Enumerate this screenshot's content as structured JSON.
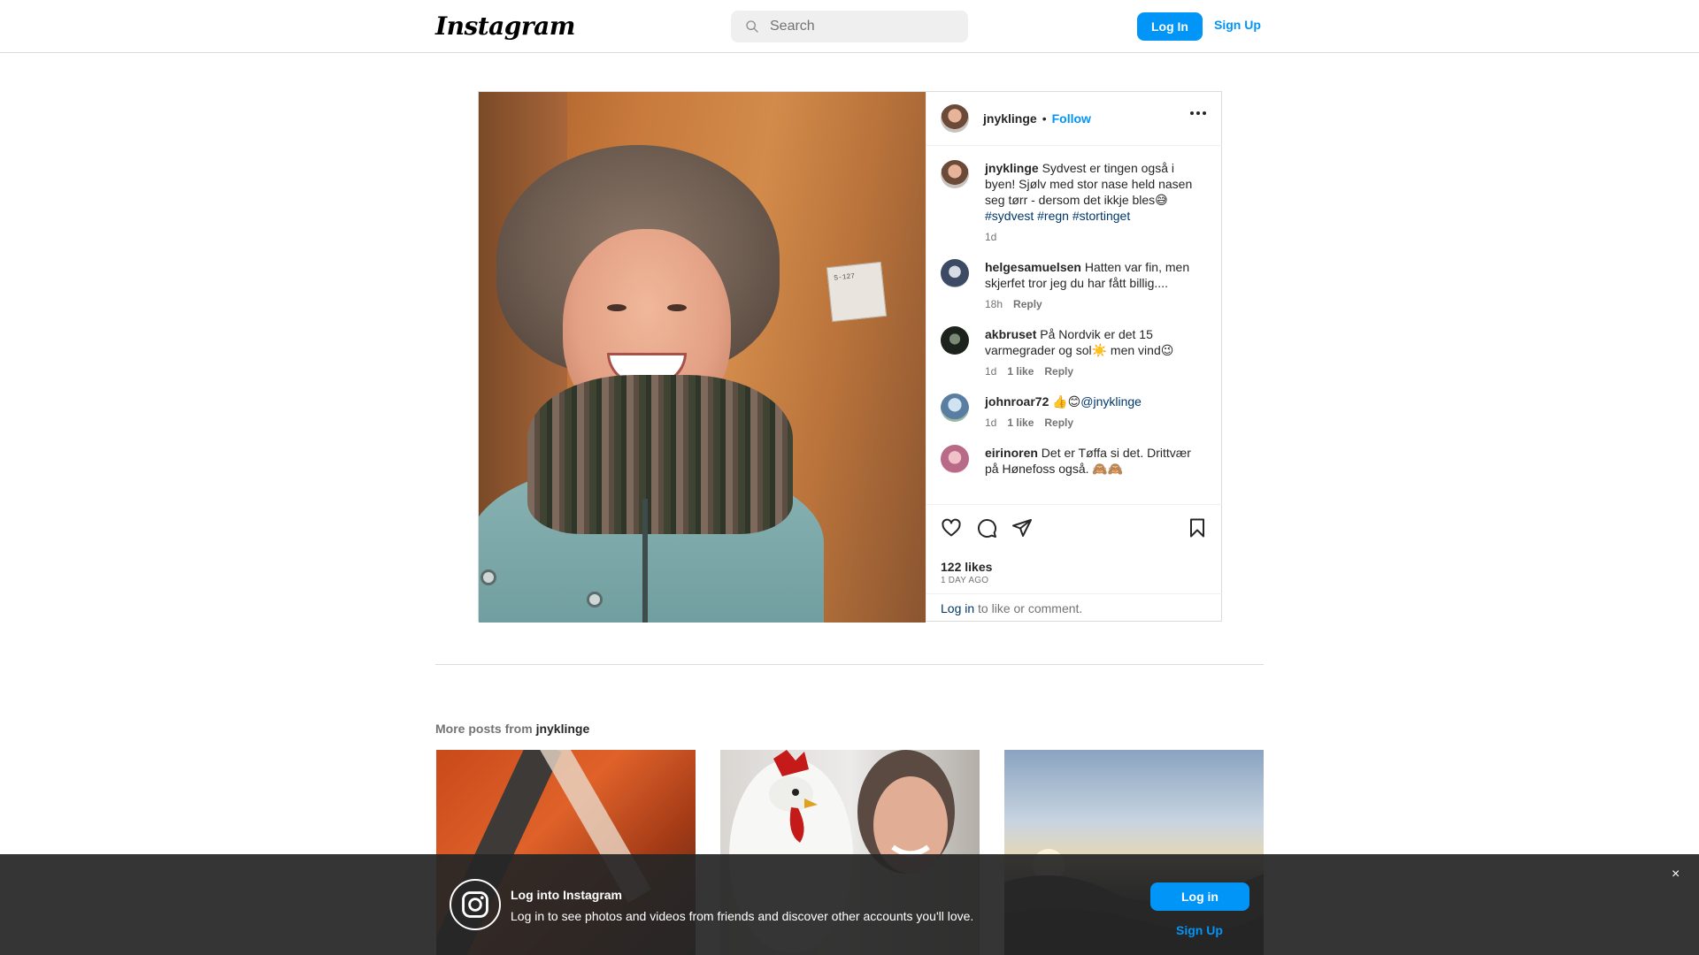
{
  "nav": {
    "logo": "Instagram",
    "search_placeholder": "Search",
    "login_label": "Log In",
    "signup_label": "Sign Up"
  },
  "post": {
    "author": "jnyklinge",
    "dot": "•",
    "follow_label": "Follow",
    "plaque_text": "S-127",
    "caption": {
      "username": "jnyklinge",
      "text": " Sydvest er tingen også i byen! Sjølv med stor nase held nasen seg tørr - dersom det ikkje bles😅 ",
      "hashtags": [
        "#sydvest",
        "#regn",
        "#stortinget"
      ],
      "time": "1d"
    },
    "comments": [
      {
        "username": "helgesamuelsen",
        "text": " Hatten var fin, men skjerfet tror jeg du har fått billig....",
        "time": "18h",
        "likes": "",
        "reply": "Reply"
      },
      {
        "username": "akbruset",
        "text": " På Nordvik er det 15 varmegrader og sol☀️ men vind😉",
        "time": "1d",
        "likes": "1 like",
        "reply": "Reply"
      },
      {
        "username": "johnroar72",
        "text": " 👍😊",
        "mention": "@jnyklinge",
        "time": "1d",
        "likes": "1 like",
        "reply": "Reply"
      },
      {
        "username": "eirinoren",
        "text": " Det er Tøffa si det. Drittvær på Hønefoss også. 🙈🙈"
      }
    ],
    "likes": "122 likes",
    "timestamp": "1 DAY AGO",
    "login_prompt": {
      "link": "Log in",
      "rest": " to like or comment."
    }
  },
  "more_posts": {
    "prefix": "More posts from ",
    "username": "jnyklinge"
  },
  "banner": {
    "title": "Log into Instagram",
    "subtitle": "Log in to see photos and videos from friends and discover other accounts you'll love.",
    "login_label": "Log in",
    "signup_label": "Sign Up",
    "close_glyph": "×"
  },
  "colors": {
    "accent": "#0095f6",
    "link": "#00376b",
    "banner_bg": "#262626"
  }
}
